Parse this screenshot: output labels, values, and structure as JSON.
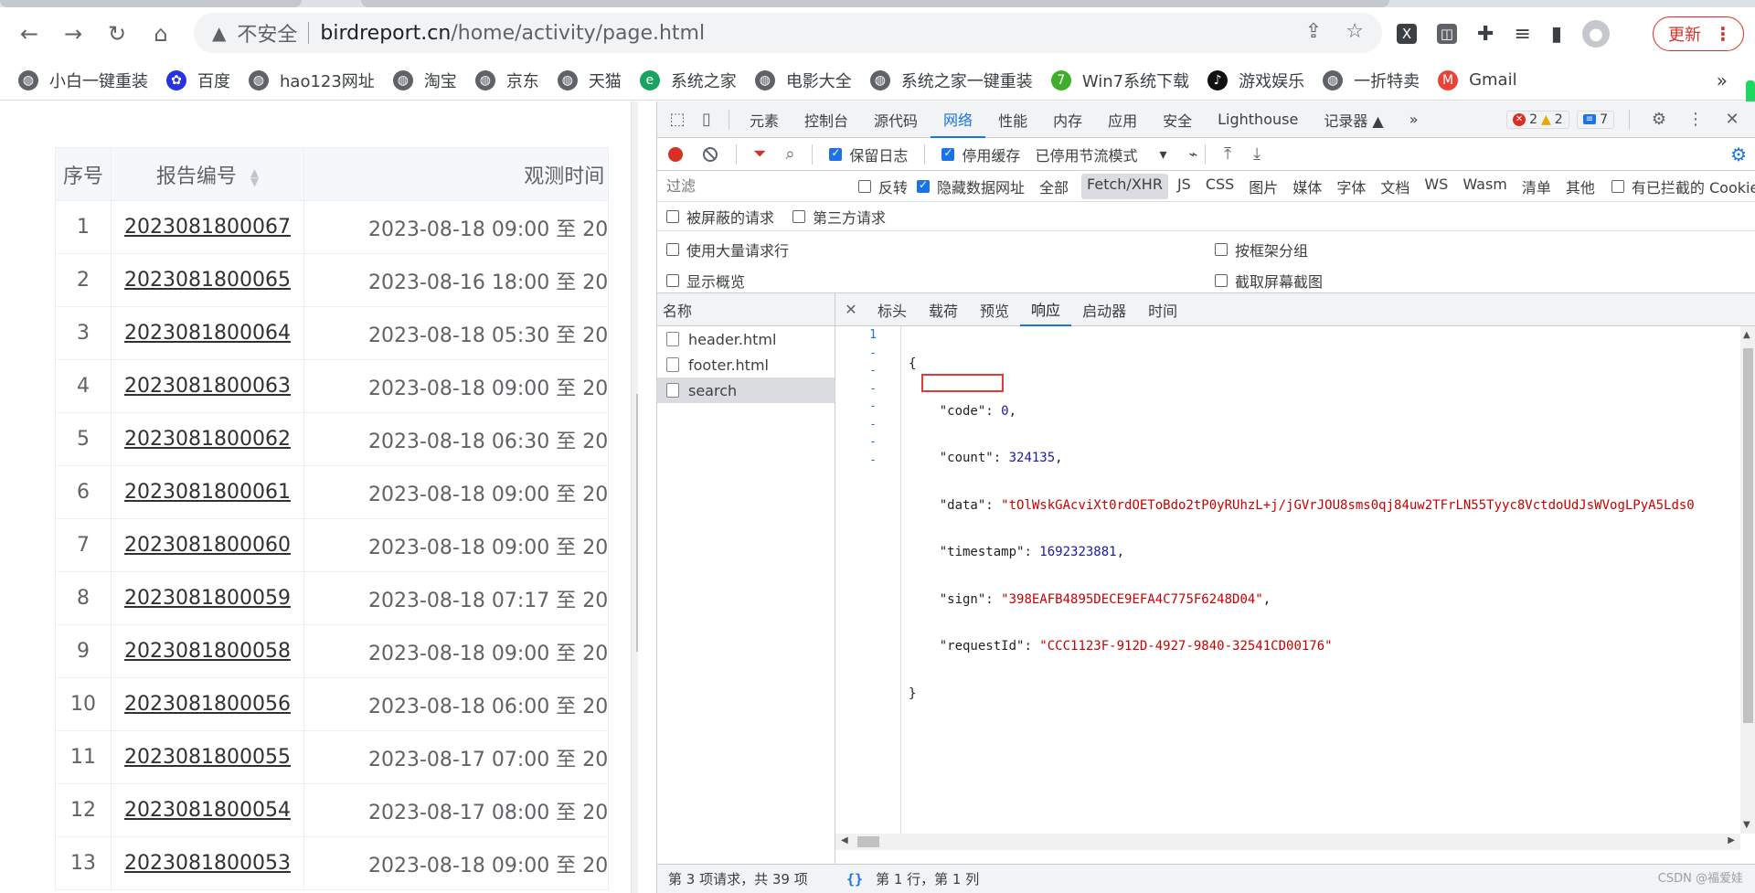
{
  "browser": {
    "security_label": "不安全",
    "url_host": "birdreport.cn",
    "url_path": "/home/activity/page.html",
    "update_label": "更新",
    "bookmarks": [
      {
        "label": "小白一键重装",
        "icon": "globe-icon"
      },
      {
        "label": "百度",
        "icon": "baidu-paw-icon"
      },
      {
        "label": "hao123网址",
        "icon": "globe-icon"
      },
      {
        "label": "淘宝",
        "icon": "globe-icon"
      },
      {
        "label": "京东",
        "icon": "globe-icon"
      },
      {
        "label": "天猫",
        "icon": "globe-icon"
      },
      {
        "label": "系统之家",
        "icon": "ie-icon"
      },
      {
        "label": "电影大全",
        "icon": "globe-icon"
      },
      {
        "label": "系统之家一键重装",
        "icon": "globe-icon"
      },
      {
        "label": "Win7系统下载",
        "icon": "seven-icon"
      },
      {
        "label": "游戏娱乐",
        "icon": "tiktok-icon"
      },
      {
        "label": "一折特卖",
        "icon": "globe-icon"
      },
      {
        "label": "Gmail",
        "icon": "gmail-icon"
      }
    ],
    "bookmarks_more": "»"
  },
  "table": {
    "headers": {
      "index": "序号",
      "report_no": "报告编号",
      "time": "观测时间"
    },
    "rows": [
      {
        "index": "1",
        "report_no": "2023081800067",
        "time": "2023-08-18 09:00 至 20"
      },
      {
        "index": "2",
        "report_no": "2023081800065",
        "time": "2023-08-16 18:00 至 20"
      },
      {
        "index": "3",
        "report_no": "2023081800064",
        "time": "2023-08-18 05:30 至 20"
      },
      {
        "index": "4",
        "report_no": "2023081800063",
        "time": "2023-08-18 09:00 至 20"
      },
      {
        "index": "5",
        "report_no": "2023081800062",
        "time": "2023-08-18 06:30 至 20"
      },
      {
        "index": "6",
        "report_no": "2023081800061",
        "time": "2023-08-18 09:00 至 20"
      },
      {
        "index": "7",
        "report_no": "2023081800060",
        "time": "2023-08-18 09:00 至 20"
      },
      {
        "index": "8",
        "report_no": "2023081800059",
        "time": "2023-08-18 07:17 至 20"
      },
      {
        "index": "9",
        "report_no": "2023081800058",
        "time": "2023-08-18 09:00 至 20"
      },
      {
        "index": "10",
        "report_no": "2023081800056",
        "time": "2023-08-18 06:00 至 20"
      },
      {
        "index": "11",
        "report_no": "2023081800055",
        "time": "2023-08-17 07:00 至 20"
      },
      {
        "index": "12",
        "report_no": "2023081800054",
        "time": "2023-08-17 08:00 至 20"
      },
      {
        "index": "13",
        "report_no": "2023081800053",
        "time": "2023-08-18 09:00 至 20"
      }
    ]
  },
  "devtools": {
    "tabs": [
      "元素",
      "控制台",
      "源代码",
      "网络",
      "性能",
      "内存",
      "应用",
      "安全",
      "Lighthouse",
      "记录器 ▲"
    ],
    "active_tab": "网络",
    "more_tabs": "»",
    "error_count": "2",
    "warning_count": "2",
    "message_count": "7",
    "controls": {
      "preserve_log": "保留日志",
      "disable_cache": "停用缓存",
      "throttling": "已停用节流模式"
    },
    "filter": {
      "placeholder": "过滤",
      "invert": "反转",
      "hide_data_urls": "隐藏数据网址",
      "all": "全部",
      "types": [
        "Fetch/XHR",
        "JS",
        "CSS",
        "图片",
        "媒体",
        "字体",
        "文档",
        "WS",
        "Wasm",
        "清单",
        "其他"
      ],
      "blocked_cookies": "有已拦截的 Cookie"
    },
    "options": {
      "blocked_requests": "被屏蔽的请求",
      "third_party": "第三方请求",
      "large_rows": "使用大量请求行",
      "group_by_frame": "按框架分组",
      "show_overview": "显示概览",
      "capture_screenshots": "截取屏幕截图"
    },
    "requests": {
      "header": "名称",
      "items": [
        "header.html",
        "footer.html",
        "search"
      ],
      "selected": "search",
      "footer": "第 3 项请求，共 39 项"
    },
    "detail": {
      "tabs": [
        "标头",
        "载荷",
        "预览",
        "响应",
        "启动器",
        "时间"
      ],
      "active_tab": "响应",
      "line_marks": [
        "1",
        "-",
        "-",
        "-",
        "-",
        "-",
        "-",
        "-"
      ],
      "response": {
        "open": "{",
        "code_key": "\"code\"",
        "code_val": "0",
        "count_key": "\"count\"",
        "count_val": "324135",
        "data_key": "\"data\"",
        "data_val": "\"tOlWskGAcviXt0rdOEToBdo2tP0yRUhzL+j/jGVrJOU8sms0qj84uw2TFrLN55Tyyc8VctdoUdJsWVogLPyA5Lds0",
        "timestamp_key": "\"timestamp\"",
        "timestamp_val": "1692323881",
        "sign_key": "\"sign\"",
        "sign_val": "\"398EAFB4895DECE9EFA4C775F6248D04\"",
        "requestId_key": "\"requestId\"",
        "requestId_val": "\"CCC1123F-912D-4927-9840-32541CD00176\"",
        "close": "}"
      },
      "status": "第 1 行，第 1 列"
    },
    "watermark": "CSDN @福爱娃"
  },
  "colors": {
    "accent": "#1a73e8",
    "error": "#d93025",
    "highlight_box": "#e53935"
  }
}
